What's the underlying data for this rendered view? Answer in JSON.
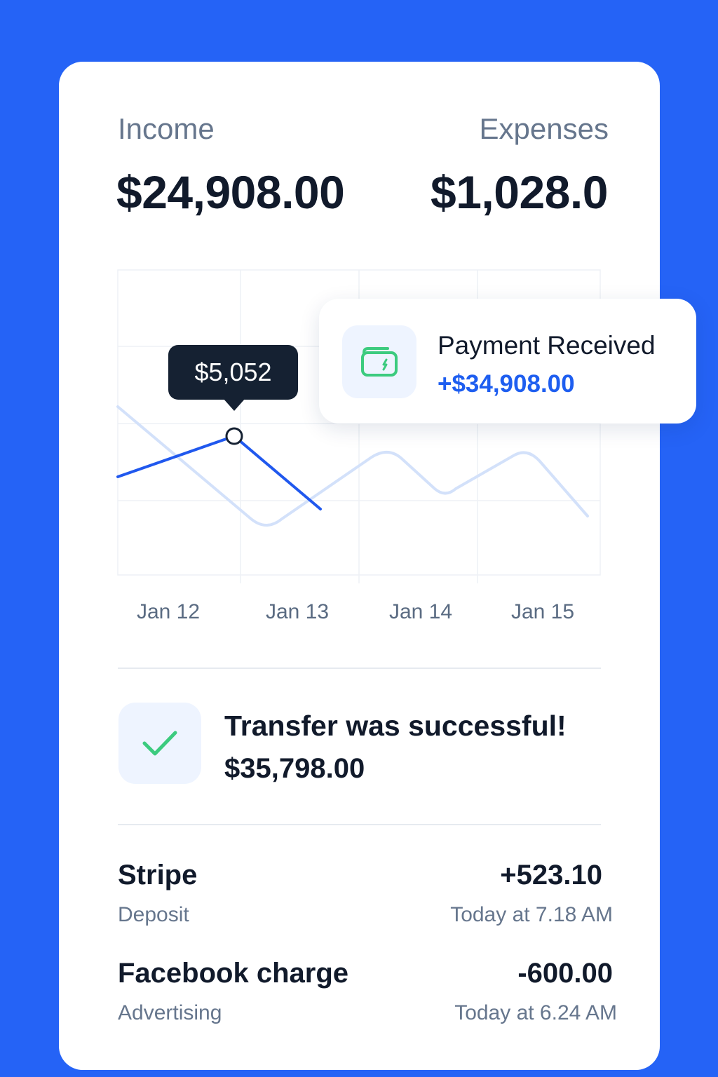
{
  "summary": {
    "income_label": "Income",
    "income_value": "$24,908.00",
    "expenses_label": "Expenses",
    "expenses_value": "$1,028.0"
  },
  "chart": {
    "x_ticks": [
      "Jan 12",
      "Jan 13",
      "Jan 14",
      "Jan 15"
    ],
    "tooltip_value": "$5,052",
    "highlight_color": "#2058EE",
    "secondary_color": "#D3E1FA"
  },
  "payment_notification": {
    "icon": "wallet-icon",
    "title": "Payment Received",
    "amount": "+$34,908.00"
  },
  "transfer": {
    "icon": "check-icon",
    "title": "Transfer was successful!",
    "amount": "$35,798.00"
  },
  "transactions": [
    {
      "name": "Stripe",
      "category": "Deposit",
      "amount": "+523.10",
      "time": "Today at 7.18 AM"
    },
    {
      "name": "Facebook charge",
      "category": "Advertising",
      "amount": "-600.00",
      "time": "Today at 6.24 AM"
    }
  ],
  "colors": {
    "background": "#2563F6",
    "accent_blue": "#1E5EF0",
    "success_green": "#3CCB7F",
    "text_dark": "#111A2B",
    "text_muted": "#66768D"
  }
}
